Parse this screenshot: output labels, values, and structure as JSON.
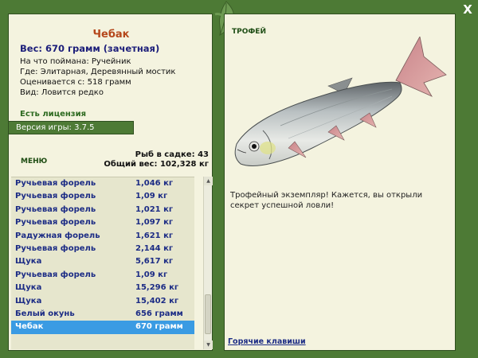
{
  "window": {
    "close_label": "X"
  },
  "catch": {
    "name": "Чебак",
    "weight": "Вес: 670 грамм (зачетная)",
    "lines": [
      "На что поймана: Ручейник",
      "Где: Элитарная, Деревянный мостик",
      "Оценивается с: 518 грамм",
      "Вид: Ловится редко"
    ]
  },
  "license": "Есть лицензия",
  "version": "Версия игры: 3.7.5",
  "menu_label": "МЕНЮ",
  "stats": {
    "count": "Рыб в садке: 43",
    "total": "Общий вес: 102,328 кг"
  },
  "list": [
    {
      "name": "Ручьевая форель",
      "weight": "1,046 кг"
    },
    {
      "name": "Ручьевая форель",
      "weight": "1,09 кг"
    },
    {
      "name": "Ручьевая форель",
      "weight": "1,021 кг"
    },
    {
      "name": "Ручьевая форель",
      "weight": "1,097 кг"
    },
    {
      "name": "Радужная форель",
      "weight": "1,621 кг"
    },
    {
      "name": "Ручьевая форель",
      "weight": "2,144 кг"
    },
    {
      "name": "Щука",
      "weight": "5,617 кг"
    },
    {
      "name": "Ручьевая форель",
      "weight": "1,09 кг"
    },
    {
      "name": "Щука",
      "weight": "15,296 кг"
    },
    {
      "name": "Щука",
      "weight": "15,402 кг"
    },
    {
      "name": "Белый окунь",
      "weight": "656 грамм"
    },
    {
      "name": "Чебак",
      "weight": "670 грамм",
      "selected": true
    }
  ],
  "trophy": {
    "title": "ТРОФЕЙ",
    "text": "Трофейный экземпляр! Кажется, вы открыли секрет успешной ловли!",
    "fish_icon": "roach-fish-illustration"
  },
  "hotkeys": "Горячие клавиши",
  "colors": {
    "frame_green": "#4d7a35",
    "panel_bg": "#f4f3df",
    "selection": "#3a9be3",
    "name_orange": "#b5471b",
    "text_navy": "#1c2c85"
  }
}
